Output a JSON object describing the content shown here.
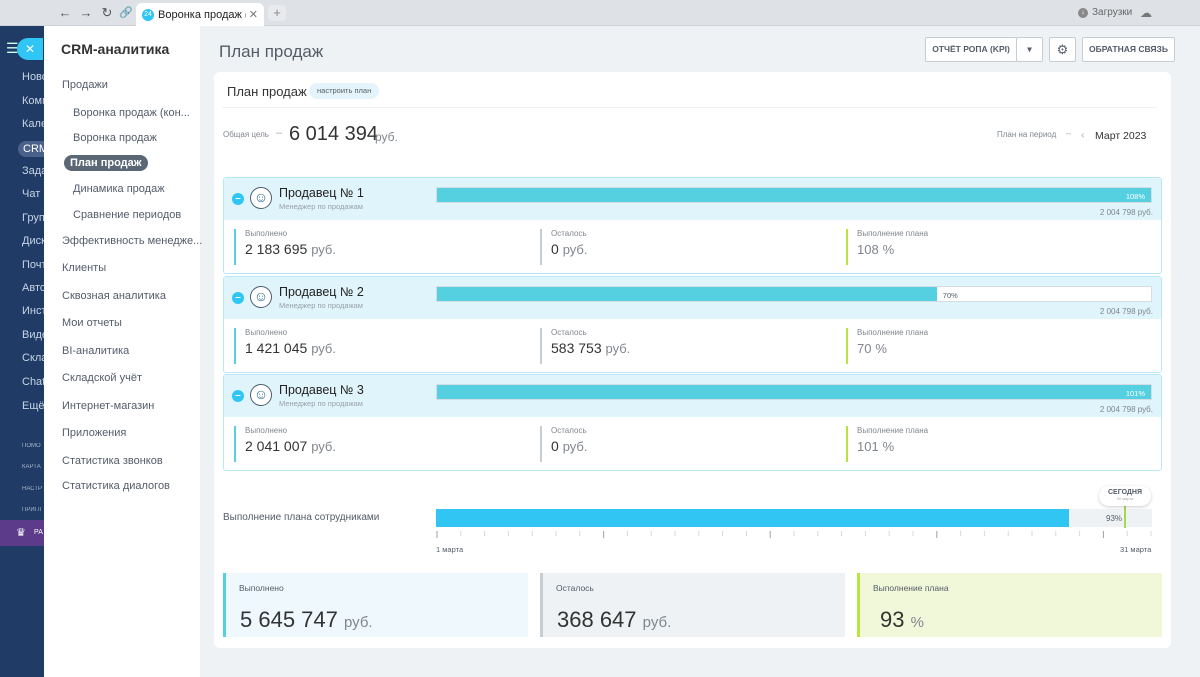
{
  "browser": {
    "tab_title": "Воронка продаж (ко...",
    "tab_favicon": "24",
    "downloads_label": "Загрузки"
  },
  "leftbar": {
    "items": [
      "Ново",
      "Комм",
      "Кале",
      "CRM",
      "Зада",
      "Чат и",
      "Груп",
      "Диск",
      "Почт",
      "Авто",
      "Инст",
      "Виде",
      "Скла",
      "Chat",
      "Ещё"
    ],
    "small_items": [
      "ПОМО",
      "КАРТА",
      "НАСТР",
      "ПРИГЛ"
    ],
    "bottom_label": "РА"
  },
  "sidebar": {
    "title": "CRM-аналитика",
    "items": [
      {
        "label": "Продажи"
      },
      {
        "label": "Воронка продаж (кон..."
      },
      {
        "label": "Воронка продаж"
      },
      {
        "label": "План продаж"
      },
      {
        "label": "Динамика продаж"
      },
      {
        "label": "Сравнение периодов"
      },
      {
        "label": "Эффективность менедже..."
      },
      {
        "label": "Клиенты"
      },
      {
        "label": "Сквозная аналитика"
      },
      {
        "label": "Мои отчеты"
      },
      {
        "label": "BI-аналитика"
      },
      {
        "label": "Складской учёт"
      },
      {
        "label": "Интернет-магазин"
      },
      {
        "label": "Приложения"
      },
      {
        "label": "Статистика звонков"
      },
      {
        "label": "Статистика диалогов"
      }
    ]
  },
  "header": {
    "page_title": "План продаж",
    "kpi_button": "ОТЧЁТ РОПА (KPI)",
    "feedback_button": "ОБРАТНАЯ СВЯЗЬ"
  },
  "plan": {
    "title": "План продаж",
    "setup_link": "настроить план",
    "goal_label": "Общая цель",
    "goal_value": "6 014 394",
    "goal_unit": "руб.",
    "period_label": "План на период",
    "period_value": "Март 2023"
  },
  "sellers": [
    {
      "name": "Продавец № 1",
      "role": "Менеджер по продажам",
      "progress": 100,
      "pct_label": "108%",
      "plan": "2 004 798 руб.",
      "metrics": [
        {
          "label": "Выполнено",
          "value": "2 183 695",
          "unit": "руб."
        },
        {
          "label": "Осталось",
          "value": "0",
          "unit": "руб."
        },
        {
          "label": "Выполнение плана",
          "value": "108",
          "unit": "%"
        }
      ]
    },
    {
      "name": "Продавец № 2",
      "role": "Менеджер по продажам",
      "progress": 70,
      "pct_label": "70%",
      "plan": "2 004 798 руб.",
      "metrics": [
        {
          "label": "Выполнено",
          "value": "1 421 045",
          "unit": "руб."
        },
        {
          "label": "Осталось",
          "value": "583 753",
          "unit": "руб."
        },
        {
          "label": "Выполнение плана",
          "value": "70",
          "unit": "%"
        }
      ]
    },
    {
      "name": "Продавец № 3",
      "role": "Менеджер по продажам",
      "progress": 100,
      "pct_label": "101%",
      "plan": "2 004 798 руб.",
      "metrics": [
        {
          "label": "Выполнено",
          "value": "2 041 007",
          "unit": "руб."
        },
        {
          "label": "Осталось",
          "value": "0",
          "unit": "руб."
        },
        {
          "label": "Выполнение плана",
          "value": "101",
          "unit": "%"
        }
      ]
    }
  ],
  "team": {
    "label": "Выполнение плана сотрудниками",
    "progress": 93,
    "pct_label": "93%",
    "today_label": "СЕГОДНЯ",
    "today_sub": "30 марта",
    "day_start": "1 марта",
    "day_end": "31 марта",
    "days": 31
  },
  "totals": {
    "done": {
      "label": "Выполнено",
      "value": "5 645 747",
      "unit": "руб."
    },
    "left": {
      "label": "Осталось",
      "value": "368 647",
      "unit": "руб."
    },
    "plan": {
      "label": "Выполнение плана",
      "value": "93",
      "unit": "%"
    }
  },
  "colors": {
    "accent": "#2fc6f6",
    "bar": "#55d0e0",
    "team_bar": "#30c5f2",
    "done_border": "#55d0e0",
    "left_border": "#c6cdd3",
    "plan_border": "#bbe33f"
  }
}
